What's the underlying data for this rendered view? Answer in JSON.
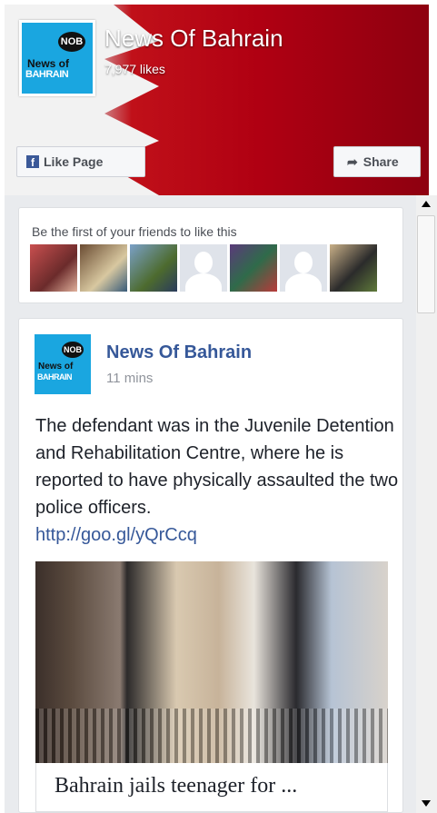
{
  "page": {
    "name": "News Of Bahrain",
    "likes": "7,977 likes",
    "logo": {
      "line1": "News of",
      "line2": "BAHRAIN",
      "badge": "NOB"
    }
  },
  "buttons": {
    "like_label": "Like Page",
    "share_label": "Share"
  },
  "friends": {
    "prompt": "Be the first of your friends to like this",
    "avatars": [
      "photo",
      "photo",
      "photo",
      "default",
      "photo",
      "default",
      "photo"
    ]
  },
  "post": {
    "author": "News Of Bahrain",
    "time": "11 mins",
    "text": "The defendant was in the Juvenile Detention and Rehabilitation Centre, where he is reported to have physically assaulted the two police officers.",
    "link": "http://goo.gl/yQrCcq",
    "link_title": "Bahrain jails teenager for ..."
  },
  "colors": {
    "brand": "#365899",
    "header_red": "#b00012",
    "logo_blue": "#1aa6e0"
  },
  "icons": [
    "facebook-icon",
    "share-arrow-icon",
    "scroll-up-icon",
    "scroll-down-icon"
  ]
}
